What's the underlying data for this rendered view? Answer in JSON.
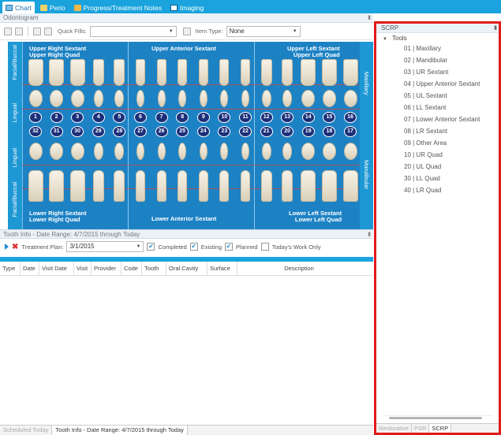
{
  "tabs": [
    {
      "label": "Chart",
      "icon": "chart-icon",
      "active": true
    },
    {
      "label": "Perio",
      "icon": "perio-icon",
      "active": false
    },
    {
      "label": "Progress/Treatment Notes",
      "icon": "notes-icon",
      "active": false
    },
    {
      "label": "Imaging",
      "icon": "imaging-icon",
      "active": false
    }
  ],
  "odontogram": {
    "title": "Odontogram",
    "quick_fills_label": "Quick Fills:",
    "quick_fills_value": "",
    "item_type_label": "Item Type:",
    "item_type_value": "None",
    "side_labels": {
      "left_top": "Facial/Buccal",
      "left_upper_mid": "Lingual",
      "left_lower_mid": "Lingual",
      "left_bottom": "Facial/Buccal",
      "right_top": "Maxillary",
      "right_bottom": "Mandibular"
    },
    "sextants": {
      "upper_right": "Upper Right Sextant",
      "upper_right_quad": "Upper Right Quad",
      "upper_anterior": "Upper Anterior Sextant",
      "upper_left": "Upper Left Sextant",
      "upper_left_quad": "Upper Left Quad",
      "lower_right": "Lower Right Sextant",
      "lower_right_quad": "Lower Right Quad",
      "lower_anterior": "Lower Anterior Sextant",
      "lower_left": "Lower Left Sextant",
      "lower_left_quad": "Lower Left Quad"
    },
    "upper_numbers": [
      "1",
      "2",
      "3",
      "4",
      "5",
      "6",
      "7",
      "8",
      "9",
      "10",
      "11",
      "12",
      "13",
      "14",
      "15",
      "16"
    ],
    "lower_numbers": [
      "32",
      "31",
      "30",
      "29",
      "28",
      "27",
      "26",
      "25",
      "24",
      "23",
      "22",
      "21",
      "20",
      "19",
      "18",
      "17"
    ]
  },
  "tooth_info": {
    "title": "Tooth Info - Date Range: 4/7/2015 through Today",
    "treatment_plan_label": "Treatment Plan:",
    "treatment_plan_value": "3/1/2015",
    "filters": [
      {
        "label": "Completed",
        "checked": true
      },
      {
        "label": "Existing",
        "checked": true
      },
      {
        "label": "Planned",
        "checked": true
      },
      {
        "label": "Today's Work Only",
        "checked": false
      }
    ],
    "columns": [
      "Type",
      "Date",
      "Visit Date",
      "Visit",
      "Provider",
      "Code",
      "Tooth",
      "Oral Cavity",
      "Surface",
      "Description"
    ]
  },
  "bottom_tabs": [
    {
      "label": "Scheduled Today",
      "active": false
    },
    {
      "label": "Tooth Info - Date Range: 4/7/2015 through Today",
      "active": true
    }
  ],
  "scrp": {
    "title": "SCRP",
    "root": "Tools",
    "items": [
      "01 | Maxillary",
      "02 | Mandibular",
      "03 | UR Sextant",
      "04 | Upper Anterior Sextant",
      "05 | UL Sextant",
      "06 | LL Sextant",
      "07 | Lower Anterior Sextant",
      "08 | LR Sextant",
      "09 | Other Area",
      "10 | UR Quad",
      "20 | UL Quad",
      "30 | LL Quad",
      "40 | LR Quad"
    ],
    "tabs": [
      {
        "label": "Restorative",
        "active": false
      },
      {
        "label": "PSR",
        "active": false
      },
      {
        "label": "SCRP",
        "active": true
      }
    ]
  },
  "colors": {
    "accent": "#1aa3dd",
    "chart_bg": "#1d82c4",
    "number_badge": "#1b2f7a",
    "highlight_border": "#e21a1a"
  }
}
